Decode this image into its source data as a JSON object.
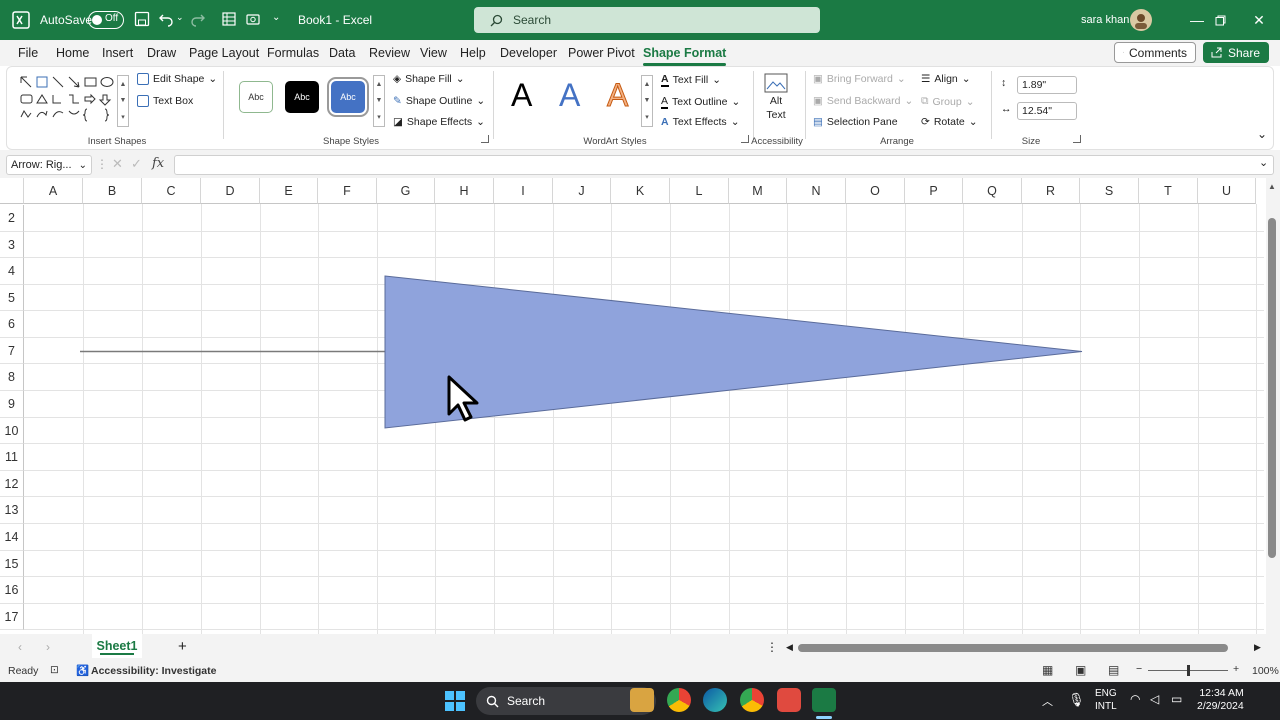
{
  "app": {
    "autosave_label": "AutoSave",
    "autosave_state": "Off",
    "doc_title": "Book1  -  Excel",
    "search_placeholder": "Search",
    "user_name": "sara khan",
    "brand_color": "#1b7a44"
  },
  "menu": {
    "tabs": [
      "File",
      "Home",
      "Insert",
      "Draw",
      "Page Layout",
      "Formulas",
      "Data",
      "Review",
      "View",
      "Help",
      "Developer",
      "Power Pivot",
      "Shape Format"
    ],
    "active_tab": "Shape Format",
    "comments_label": "Comments",
    "share_label": "Share"
  },
  "ribbon": {
    "insert_shapes": {
      "label": "Insert Shapes",
      "edit_shape": "Edit Shape",
      "text_box": "Text Box"
    },
    "shape_styles": {
      "label": "Shape Styles",
      "swatch_text": "Abc",
      "shape_fill": "Shape Fill",
      "shape_outline": "Shape Outline",
      "shape_effects": "Shape Effects"
    },
    "wordart": {
      "label": "WordArt Styles",
      "letter": "A",
      "text_fill": "Text Fill",
      "text_outline": "Text Outline",
      "text_effects": "Text Effects"
    },
    "accessibility": {
      "label": "Accessibility",
      "alt_text_line1": "Alt",
      "alt_text_line2": "Text"
    },
    "arrange": {
      "label": "Arrange",
      "bring_forward": "Bring Forward",
      "send_backward": "Send Backward",
      "selection_pane": "Selection Pane",
      "align": "Align",
      "group": "Group",
      "rotate": "Rotate"
    },
    "size": {
      "label": "Size",
      "height": "1.89\"",
      "width": "12.54\""
    }
  },
  "formula_bar": {
    "name_box": "Arrow: Rig...",
    "fx_label": "fx",
    "formula": ""
  },
  "grid": {
    "columns": [
      "A",
      "B",
      "C",
      "D",
      "E",
      "F",
      "G",
      "H",
      "I",
      "J",
      "K",
      "L",
      "M",
      "N",
      "O",
      "P",
      "Q",
      "R",
      "S",
      "T",
      "U"
    ],
    "rows": [
      "2",
      "3",
      "4",
      "5",
      "6",
      "7",
      "8",
      "9",
      "10",
      "11",
      "12",
      "13",
      "14",
      "15",
      "16",
      "17"
    ],
    "shape_fill_color": "#8fa3dc",
    "shape_stroke_color": "#5a6b9a"
  },
  "sheets": {
    "tabs": [
      "Sheet1"
    ],
    "add_label": "+"
  },
  "status": {
    "ready": "Ready",
    "accessibility": "Accessibility: Investigate",
    "zoom": "100%"
  },
  "taskbar": {
    "search_label": "Search",
    "lang_line1": "ENG",
    "lang_line2": "INTL",
    "time": "12:34 AM",
    "date": "2/29/2024"
  }
}
